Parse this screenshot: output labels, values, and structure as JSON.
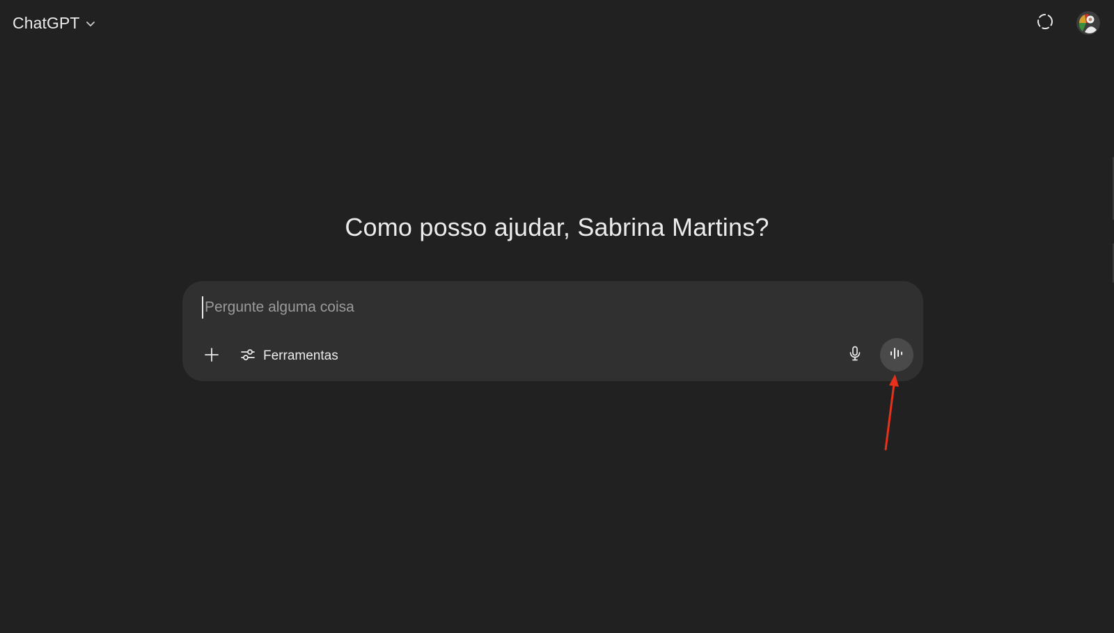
{
  "header": {
    "model_name": "ChatGPT",
    "model_switcher_icon": "chevron-down-icon",
    "temporary_chat_icon": "dashed-circle-icon",
    "avatar_icon": "user-avatar"
  },
  "main": {
    "greeting": "Como posso ajudar, Sabrina Martins?"
  },
  "composer": {
    "placeholder": "Pergunte alguma coisa",
    "value": "",
    "add_icon": "plus-icon",
    "tools_icon": "sliders-icon",
    "tools_label": "Ferramentas",
    "mic_icon": "microphone-icon",
    "voice_icon": "voice-waveform-icon"
  },
  "annotation": {
    "arrow_color": "#e8311b",
    "points_to": "voice-mode-button"
  },
  "colors": {
    "background": "#212121",
    "composer": "#303030",
    "voice_button": "#4a4a4a",
    "text": "#ececec",
    "placeholder": "#9b9b9b"
  }
}
